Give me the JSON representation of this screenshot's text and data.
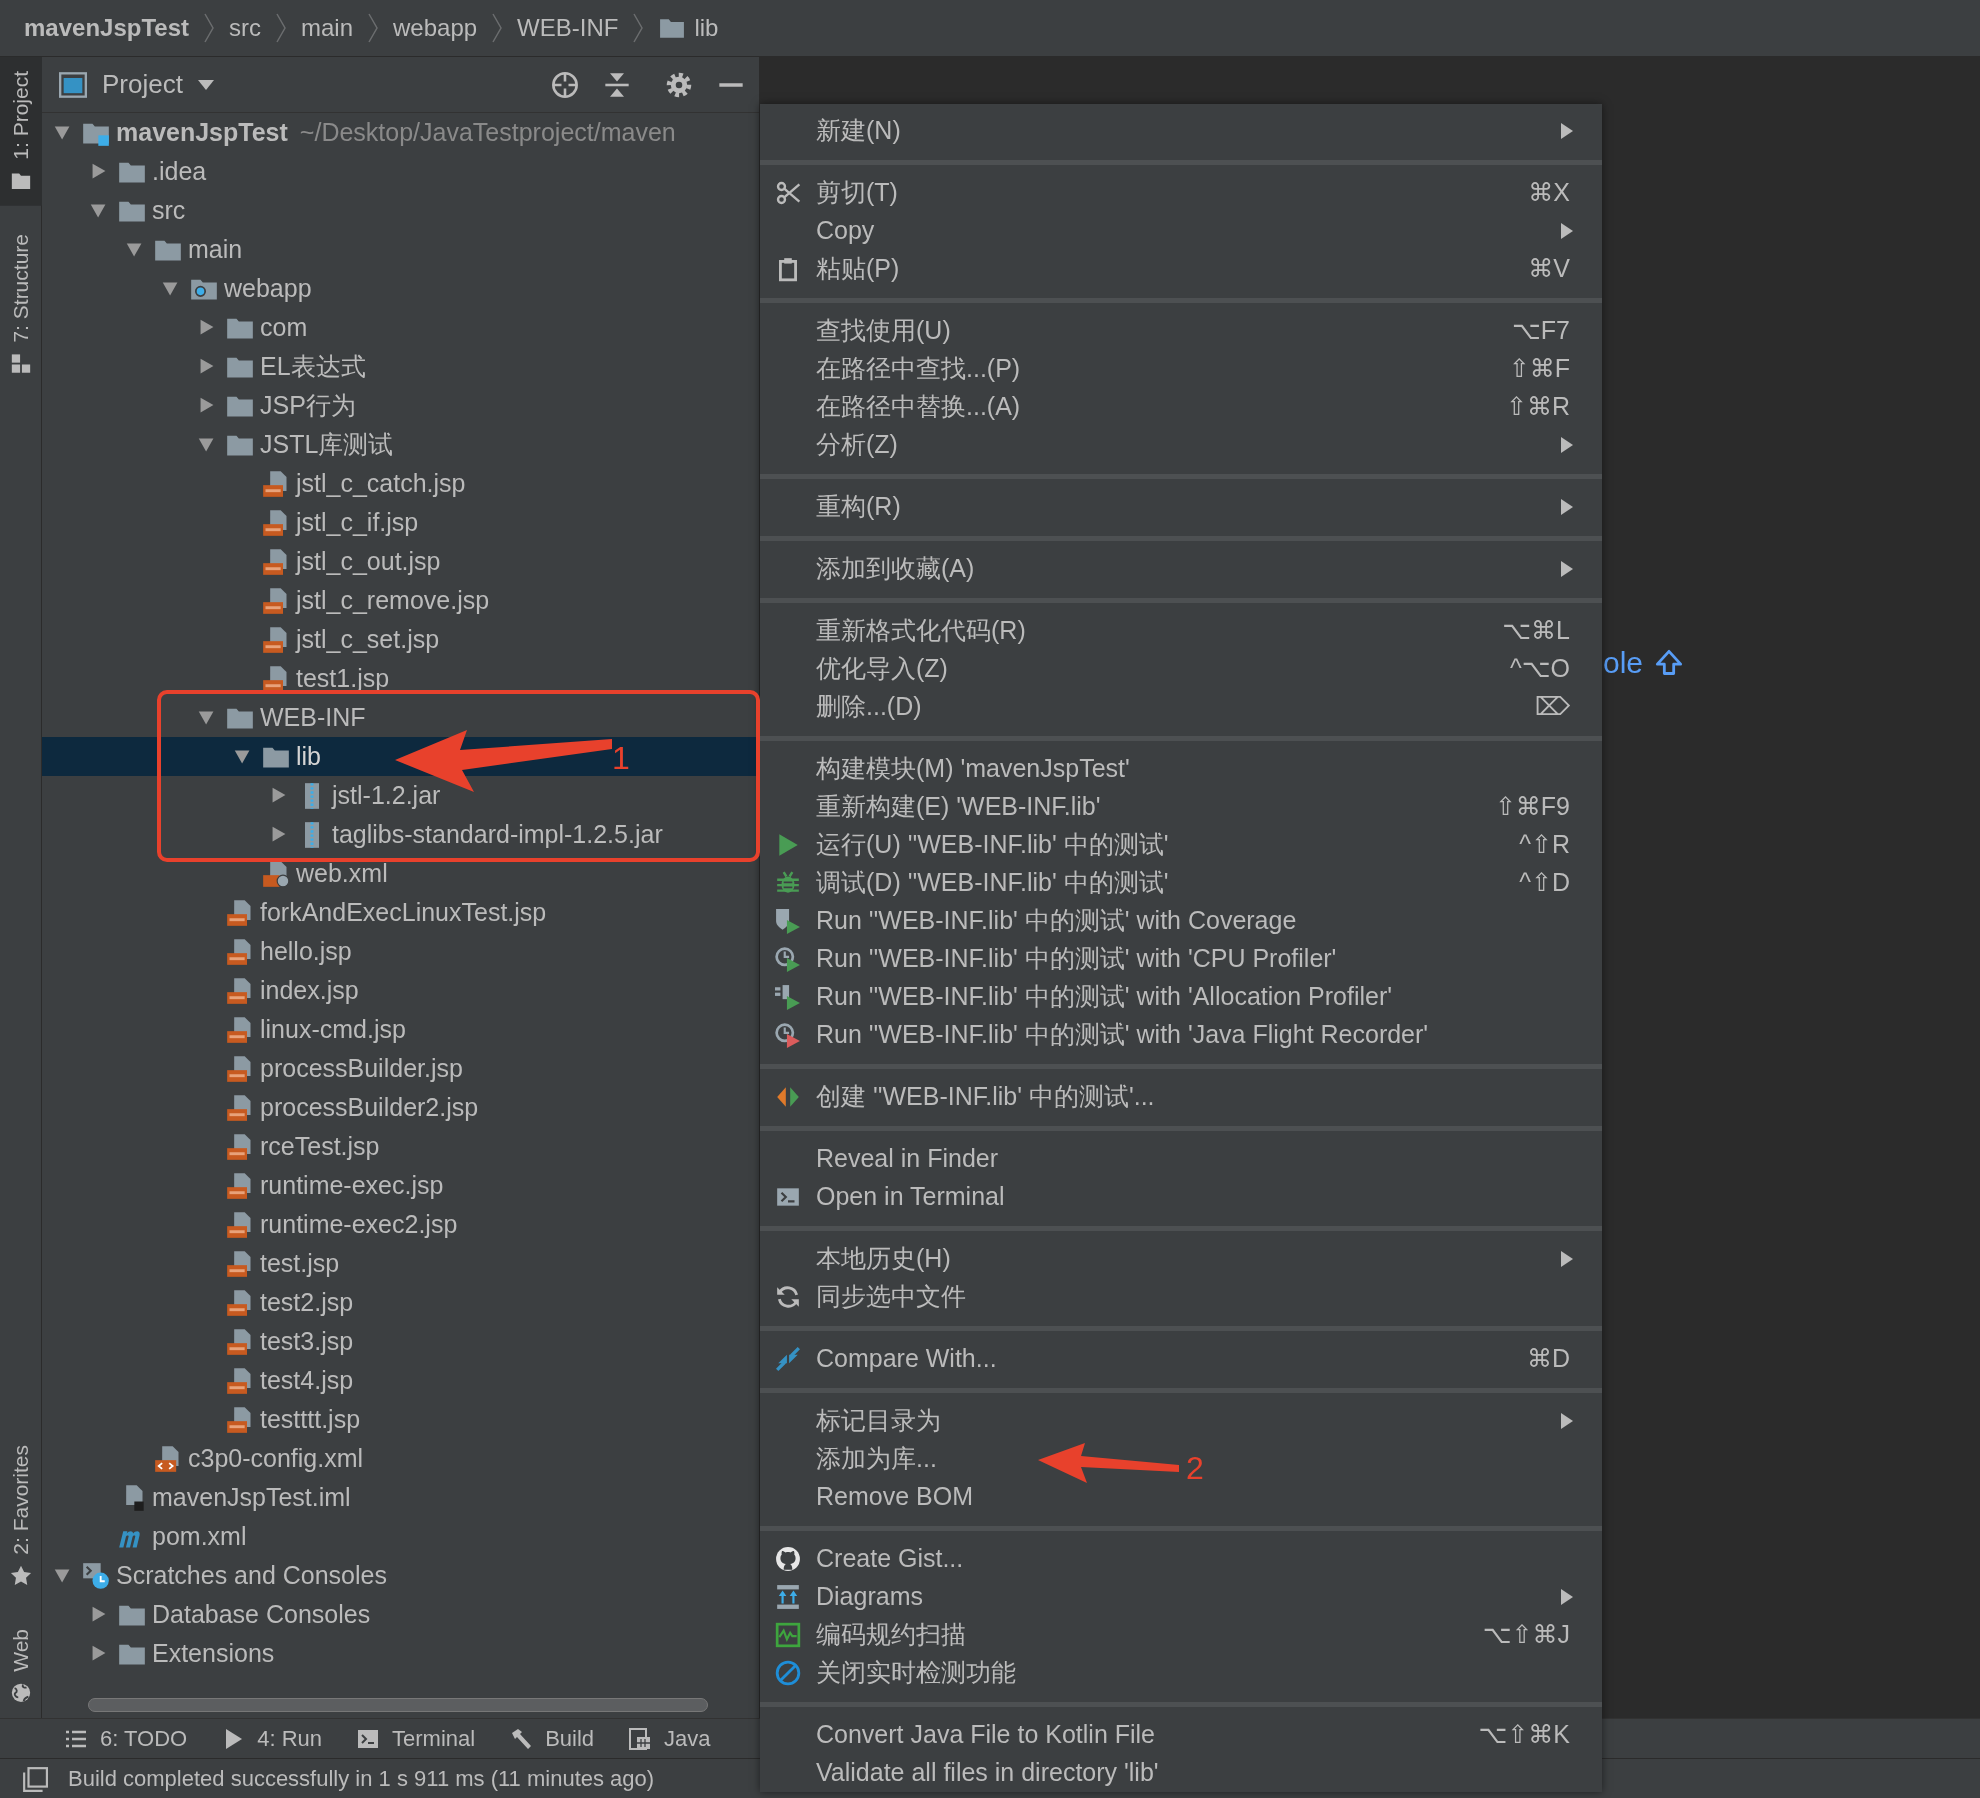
{
  "breadcrumb": [
    {
      "label": "mavenJspTest",
      "kind": "project"
    },
    {
      "label": "src",
      "kind": "plain"
    },
    {
      "label": "main",
      "kind": "plain"
    },
    {
      "label": "webapp",
      "kind": "plain"
    },
    {
      "label": "WEB-INF",
      "kind": "plain"
    },
    {
      "label": "lib",
      "kind": "folder"
    }
  ],
  "tool_strip": {
    "top": [
      {
        "label": "1: Project",
        "kind": "project",
        "selected": true
      },
      {
        "label": "7: Structure",
        "kind": "structure",
        "selected": false
      }
    ],
    "bottom": [
      {
        "label": "2: Favorites",
        "kind": "favorites",
        "selected": false
      },
      {
        "label": "Web",
        "kind": "web",
        "selected": false
      }
    ]
  },
  "project_panel": {
    "title": "Project",
    "tree": [
      {
        "label": "mavenJspTest",
        "kind": "module",
        "path": "~/Desktop/JavaTestproject/maven",
        "expanded": true,
        "selected": false,
        "children": [
          {
            "label": ".idea",
            "kind": "folder",
            "expanded": false,
            "selected": false
          },
          {
            "label": "src",
            "kind": "folder",
            "expanded": true,
            "selected": false,
            "children": [
              {
                "label": "main",
                "kind": "folder",
                "expanded": true,
                "selected": false,
                "children": [
                  {
                    "label": "webapp",
                    "kind": "web-folder",
                    "expanded": true,
                    "selected": false,
                    "children": [
                      {
                        "label": "com",
                        "kind": "folder",
                        "expanded": false,
                        "selected": false
                      },
                      {
                        "label": "EL表达式",
                        "kind": "folder",
                        "expanded": false,
                        "selected": false
                      },
                      {
                        "label": "JSP行为",
                        "kind": "folder",
                        "expanded": false,
                        "selected": false
                      },
                      {
                        "label": "JSTL库测试",
                        "kind": "folder",
                        "expanded": true,
                        "selected": false,
                        "children": [
                          {
                            "label": "jstl_c_catch.jsp",
                            "kind": "jsp",
                            "selected": false
                          },
                          {
                            "label": "jstl_c_if.jsp",
                            "kind": "jsp",
                            "selected": false
                          },
                          {
                            "label": "jstl_c_out.jsp",
                            "kind": "jsp",
                            "selected": false
                          },
                          {
                            "label": "jstl_c_remove.jsp",
                            "kind": "jsp",
                            "selected": false
                          },
                          {
                            "label": "jstl_c_set.jsp",
                            "kind": "jsp",
                            "selected": false
                          },
                          {
                            "label": "test1.jsp",
                            "kind": "jsp",
                            "selected": false
                          }
                        ]
                      },
                      {
                        "label": "WEB-INF",
                        "kind": "folder",
                        "expanded": true,
                        "selected": false,
                        "children": [
                          {
                            "label": "lib",
                            "kind": "folder",
                            "expanded": true,
                            "selected": true,
                            "children": [
                              {
                                "label": "jstl-1.2.jar",
                                "kind": "jar",
                                "expanded": false,
                                "selected": false
                              },
                              {
                                "label": "taglibs-standard-impl-1.2.5.jar",
                                "kind": "jar",
                                "expanded": false,
                                "selected": false
                              }
                            ]
                          },
                          {
                            "label": "web.xml",
                            "kind": "web-xml",
                            "selected": false
                          }
                        ]
                      },
                      {
                        "label": "forkAndExecLinuxTest.jsp",
                        "kind": "jsp",
                        "selected": false
                      },
                      {
                        "label": "hello.jsp",
                        "kind": "jsp",
                        "selected": false
                      },
                      {
                        "label": "index.jsp",
                        "kind": "jsp",
                        "selected": false
                      },
                      {
                        "label": "linux-cmd.jsp",
                        "kind": "jsp",
                        "selected": false
                      },
                      {
                        "label": "processBuilder.jsp",
                        "kind": "jsp",
                        "selected": false
                      },
                      {
                        "label": "processBuilder2.jsp",
                        "kind": "jsp",
                        "selected": false
                      },
                      {
                        "label": "rceTest.jsp",
                        "kind": "jsp",
                        "selected": false
                      },
                      {
                        "label": "runtime-exec.jsp",
                        "kind": "jsp",
                        "selected": false
                      },
                      {
                        "label": "runtime-exec2.jsp",
                        "kind": "jsp",
                        "selected": false
                      },
                      {
                        "label": "test.jsp",
                        "kind": "jsp",
                        "selected": false
                      },
                      {
                        "label": "test2.jsp",
                        "kind": "jsp",
                        "selected": false
                      },
                      {
                        "label": "test3.jsp",
                        "kind": "jsp",
                        "selected": false
                      },
                      {
                        "label": "test4.jsp",
                        "kind": "jsp",
                        "selected": false
                      },
                      {
                        "label": "testttt.jsp",
                        "kind": "jsp",
                        "selected": false
                      }
                    ]
                  }
                ]
              },
              {
                "label": "c3p0-config.xml",
                "kind": "xml",
                "selected": false
              }
            ]
          },
          {
            "label": "mavenJspTest.iml",
            "kind": "iml",
            "selected": false
          },
          {
            "label": "pom.xml",
            "kind": "maven",
            "selected": false
          }
        ]
      },
      {
        "label": "Scratches and Consoles",
        "kind": "scratches",
        "expanded": true,
        "selected": false,
        "children": [
          {
            "label": "Database Consoles",
            "kind": "folder",
            "expanded": false,
            "selected": false
          },
          {
            "label": "Extensions",
            "kind": "folder",
            "expanded": false,
            "selected": false
          }
        ]
      }
    ]
  },
  "editor": {
    "hint": "ole"
  },
  "context_menu": {
    "groups": [
      [
        {
          "label": "新建(N)",
          "kind": "plain",
          "submenu": true
        }
      ],
      [
        {
          "label": "剪切(T)",
          "kind": "cut",
          "shortcut": "⌘X"
        },
        {
          "label": "Copy",
          "kind": "plain",
          "submenu": true
        },
        {
          "label": "粘贴(P)",
          "kind": "paste",
          "shortcut": "⌘V"
        }
      ],
      [
        {
          "label": "查找使用(U)",
          "kind": "plain",
          "shortcut": "⌥F7"
        },
        {
          "label": "在路径中查找...(P)",
          "kind": "plain",
          "shortcut": "⇧⌘F"
        },
        {
          "label": "在路径中替换...(A)",
          "kind": "plain",
          "shortcut": "⇧⌘R"
        },
        {
          "label": "分析(Z)",
          "kind": "plain",
          "submenu": true
        }
      ],
      [
        {
          "label": "重构(R)",
          "kind": "plain",
          "submenu": true
        }
      ],
      [
        {
          "label": "添加到收藏(A)",
          "kind": "plain",
          "submenu": true
        }
      ],
      [
        {
          "label": "重新格式化代码(R)",
          "kind": "plain",
          "shortcut": "⌥⌘L"
        },
        {
          "label": "优化导入(Z)",
          "kind": "plain",
          "shortcut": "^⌥O"
        },
        {
          "label": "删除...(D)",
          "kind": "plain",
          "shortcut": "⌦"
        }
      ],
      [
        {
          "label": "构建模块(M) 'mavenJspTest'",
          "kind": "plain"
        },
        {
          "label": "重新构建(E) 'WEB-INF.lib'",
          "kind": "plain",
          "shortcut": "⇧⌘F9"
        },
        {
          "label": "运行(U) ''WEB-INF.lib' 中的测试'",
          "kind": "run",
          "shortcut": "^⇧R"
        },
        {
          "label": "调试(D) ''WEB-INF.lib' 中的测试'",
          "kind": "debug",
          "shortcut": "^⇧D"
        },
        {
          "label": "Run ''WEB-INF.lib' 中的测试' with Coverage",
          "kind": "coverage"
        },
        {
          "label": "Run ''WEB-INF.lib' 中的测试' with 'CPU Profiler'",
          "kind": "cpu"
        },
        {
          "label": "Run ''WEB-INF.lib' 中的测试' with 'Allocation Profiler'",
          "kind": "alloc"
        },
        {
          "label": "Run ''WEB-INF.lib' 中的测试' with 'Java Flight Recorder'",
          "kind": "jfr"
        }
      ],
      [
        {
          "label": "创建 ''WEB-INF.lib' 中的测试'...",
          "kind": "create"
        }
      ],
      [
        {
          "label": "Reveal in Finder",
          "kind": "plain"
        },
        {
          "label": "Open in Terminal",
          "kind": "terminal"
        }
      ],
      [
        {
          "label": "本地历史(H)",
          "kind": "plain",
          "submenu": true
        },
        {
          "label": "同步选中文件",
          "kind": "sync"
        }
      ],
      [
        {
          "label": "Compare With...",
          "kind": "compare",
          "shortcut": "⌘D"
        }
      ],
      [
        {
          "label": "标记目录为",
          "kind": "plain",
          "submenu": true
        },
        {
          "label": "添加为库...",
          "kind": "plain"
        },
        {
          "label": "Remove BOM",
          "kind": "plain"
        }
      ],
      [
        {
          "label": "Create Gist...",
          "kind": "gist"
        },
        {
          "label": "Diagrams",
          "kind": "diagrams",
          "submenu": true
        },
        {
          "label": "编码规约扫描",
          "kind": "scan",
          "shortcut": "⌥⇧⌘J"
        },
        {
          "label": "关闭实时检测功能",
          "kind": "disable"
        }
      ],
      [
        {
          "label": "Convert Java File to Kotlin File",
          "kind": "plain",
          "shortcut": "⌥⇧⌘K"
        },
        {
          "label": "Validate all files in directory 'lib'",
          "kind": "plain"
        }
      ]
    ]
  },
  "annotations": [
    {
      "label": "1"
    },
    {
      "label": "2"
    }
  ],
  "bottom_toolbar": [
    {
      "label": "6: TODO",
      "kind": "todo"
    },
    {
      "label": "4: Run",
      "kind": "run"
    },
    {
      "label": "Terminal",
      "kind": "terminal"
    },
    {
      "label": "Build",
      "kind": "build"
    },
    {
      "label": "Java",
      "kind": "java"
    }
  ],
  "status_bar": {
    "message": "Build completed successfully in 1 s 911 ms (11 minutes ago)"
  }
}
